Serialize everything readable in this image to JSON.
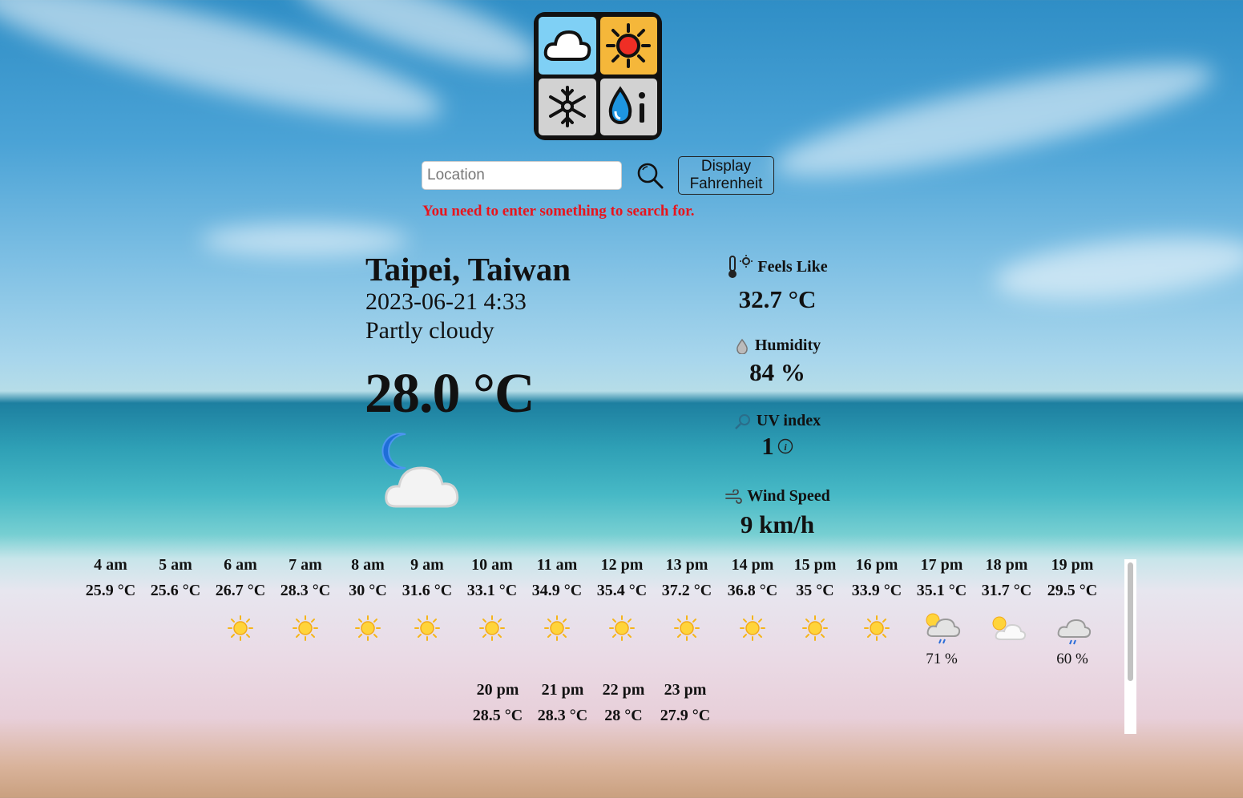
{
  "search": {
    "placeholder": "Location",
    "value": ""
  },
  "unit_toggle_label": "Display Fahrenheit",
  "error_message": "You need to enter something to search for.",
  "current": {
    "location": "Taipei, Taiwan",
    "datetime": "2023-06-21 4:33",
    "condition": "Partly cloudy",
    "temperature": "28.0 °C",
    "icon": "moon-cloud-icon"
  },
  "stats": {
    "feels_like": {
      "label": "Feels Like",
      "value": "32.7 °C",
      "icon": "thermometer-sun-icon"
    },
    "humidity": {
      "label": "Humidity",
      "value": "84 %",
      "icon": "droplet-icon"
    },
    "uv_index": {
      "label": "UV index",
      "value": "1",
      "icon": "uv-icon"
    },
    "wind_speed": {
      "label": "Wind Speed",
      "value": "9 km/h",
      "icon": "wind-icon"
    }
  },
  "hourly": [
    {
      "time": "4 am",
      "temp": "25.9 °C",
      "icon": "moon-icon",
      "rain": ""
    },
    {
      "time": "5 am",
      "temp": "25.6 °C",
      "icon": "moon-icon",
      "rain": ""
    },
    {
      "time": "6 am",
      "temp": "26.7 °C",
      "icon": "sun-icon",
      "rain": ""
    },
    {
      "time": "7 am",
      "temp": "28.3 °C",
      "icon": "sun-icon",
      "rain": ""
    },
    {
      "time": "8 am",
      "temp": "30 °C",
      "icon": "sun-icon",
      "rain": ""
    },
    {
      "time": "9 am",
      "temp": "31.6 °C",
      "icon": "sun-icon",
      "rain": ""
    },
    {
      "time": "10 am",
      "temp": "33.1 °C",
      "icon": "sun-icon",
      "rain": ""
    },
    {
      "time": "11 am",
      "temp": "34.9 °C",
      "icon": "sun-icon",
      "rain": ""
    },
    {
      "time": "12 pm",
      "temp": "35.4 °C",
      "icon": "sun-icon",
      "rain": ""
    },
    {
      "time": "13 pm",
      "temp": "37.2 °C",
      "icon": "sun-icon",
      "rain": ""
    },
    {
      "time": "14 pm",
      "temp": "36.8 °C",
      "icon": "sun-icon",
      "rain": ""
    },
    {
      "time": "15 pm",
      "temp": "35 °C",
      "icon": "sun-icon",
      "rain": ""
    },
    {
      "time": "16 pm",
      "temp": "33.9 °C",
      "icon": "sun-icon",
      "rain": ""
    },
    {
      "time": "17 pm",
      "temp": "35.1 °C",
      "icon": "sun-rain-icon",
      "rain": "71 %"
    },
    {
      "time": "18 pm",
      "temp": "31.7 °C",
      "icon": "sun-cloud-icon",
      "rain": ""
    },
    {
      "time": "19 pm",
      "temp": "29.5 °C",
      "icon": "moon-rain-icon",
      "rain": "60 %"
    },
    {
      "time": "20 pm",
      "temp": "28.5 °C",
      "icon": "",
      "rain": ""
    },
    {
      "time": "21 pm",
      "temp": "28.3 °C",
      "icon": "",
      "rain": ""
    },
    {
      "time": "22 pm",
      "temp": "28 °C",
      "icon": "",
      "rain": ""
    },
    {
      "time": "23 pm",
      "temp": "27.9 °C",
      "icon": "",
      "rain": ""
    }
  ],
  "colors": {
    "error": "#e8141c",
    "logo_sky": "#7fd0f5",
    "logo_sun": "#f5b73a",
    "logo_grey": "#d2d2d2"
  }
}
